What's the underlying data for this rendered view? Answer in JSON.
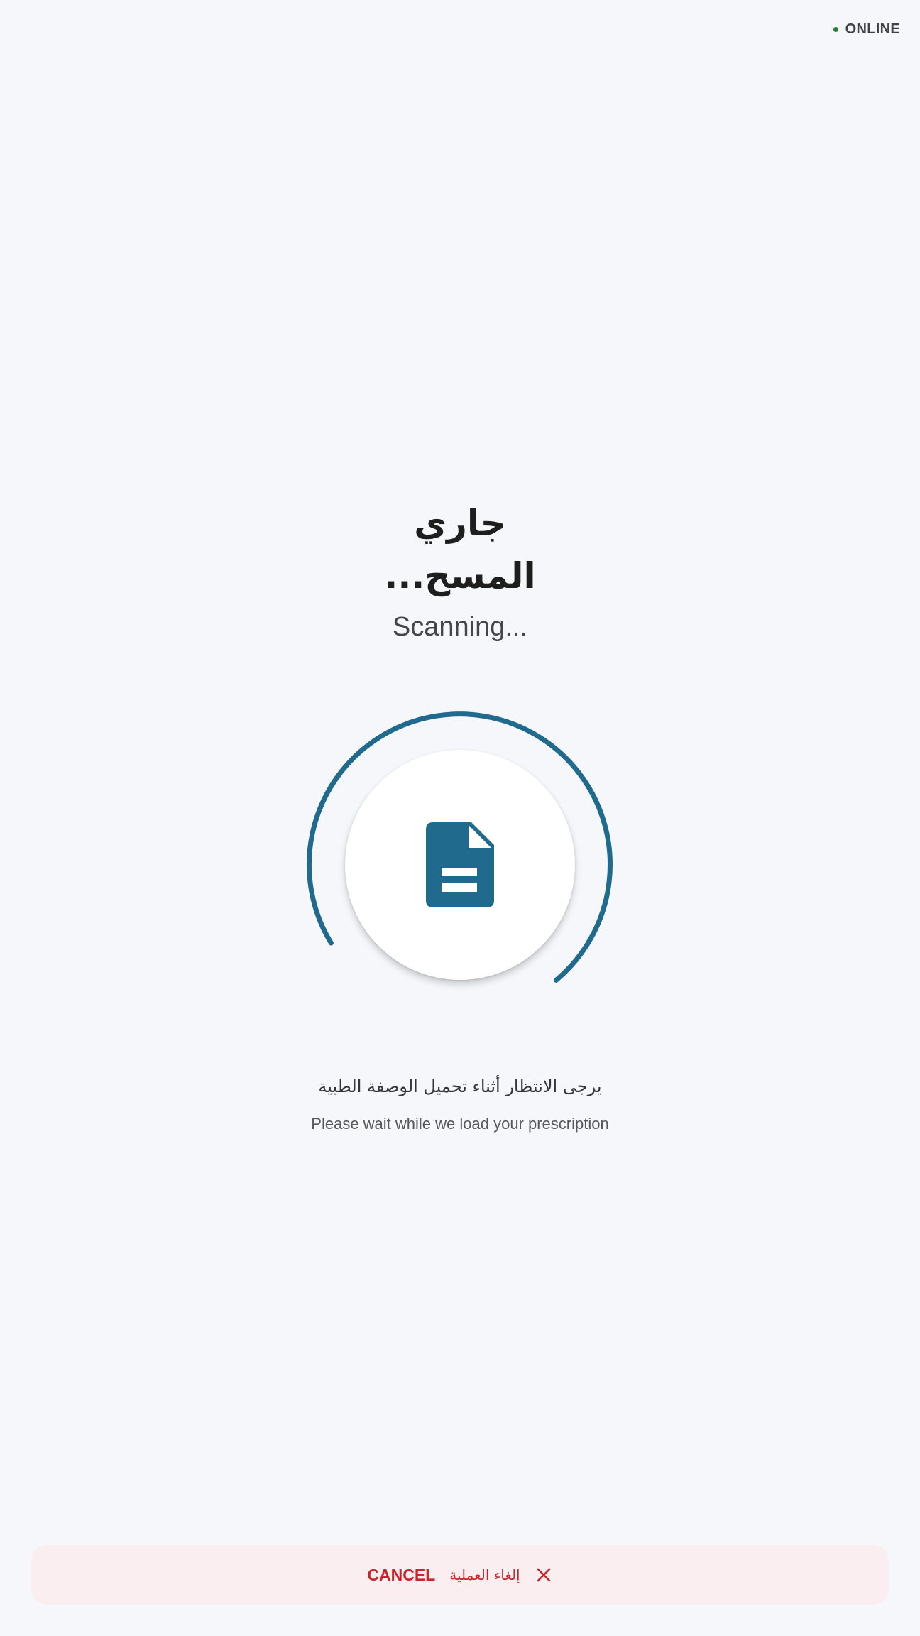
{
  "status": {
    "label": "ONLINE",
    "color": "#2e7d32"
  },
  "heading": {
    "arabic_line1": "جاري",
    "arabic_line2": "المسح...",
    "english": "Scanning..."
  },
  "spinner": {
    "icon": "document-icon",
    "accent_color": "#1f6a8d"
  },
  "message": {
    "arabic": "يرجى الانتظار أثناء تحميل الوصفة الطبية",
    "english": "Please wait while we load your prescription"
  },
  "cancel_button": {
    "label_en": "CANCEL",
    "label_ar": "إلغاء العملية",
    "icon": "close-icon",
    "color": "#c62828"
  }
}
